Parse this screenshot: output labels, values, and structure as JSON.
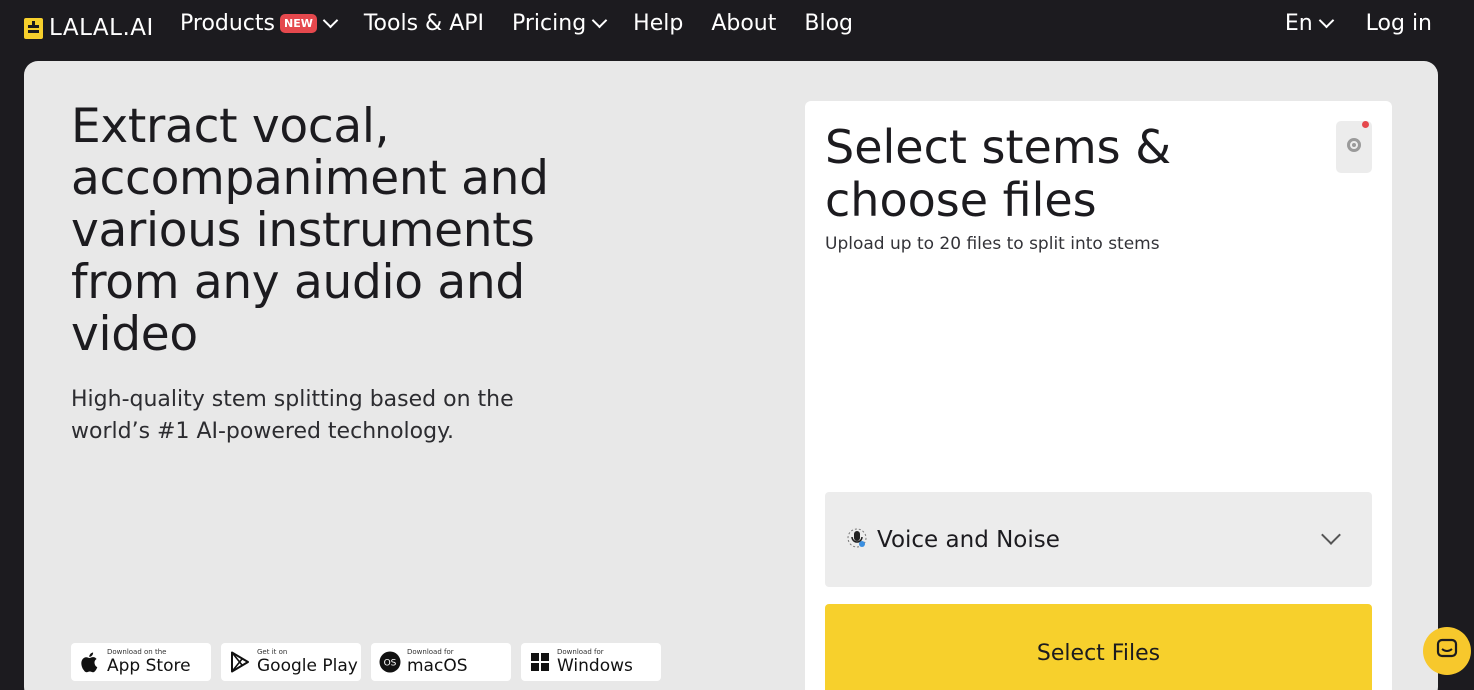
{
  "brand": {
    "name": "LALAL.AI",
    "accent": "#f7d02c"
  },
  "nav": {
    "products": "Products",
    "new_badge": "NEW",
    "tools": "Tools & API",
    "pricing": "Pricing",
    "help": "Help",
    "about": "About",
    "blog": "Blog",
    "language": "En",
    "login": "Log in"
  },
  "hero": {
    "title": "Extract vocal, accompaniment and various instruments from any audio and video",
    "subtitle": "High-quality stem splitting based on the world’s #1 AI-powered technology."
  },
  "stores": [
    {
      "small": "Download on the",
      "big": "App Store",
      "icon": "apple-icon"
    },
    {
      "small": "Get it on",
      "big": "Google Play",
      "icon": "google-play-icon"
    },
    {
      "small": "Download for",
      "big": "macOS",
      "icon": "macos-icon"
    },
    {
      "small": "Download for",
      "big": "Windows",
      "icon": "windows-icon"
    }
  ],
  "panel": {
    "title": "Select stems & choose files",
    "subtitle": "Upload up to 20 files to split into stems",
    "stem_selected": "Voice and Noise",
    "select_button": "Select Files"
  },
  "colors": {
    "background": "#1c1b1f",
    "card": "#e8e8e8",
    "notify": "#e5484d"
  }
}
